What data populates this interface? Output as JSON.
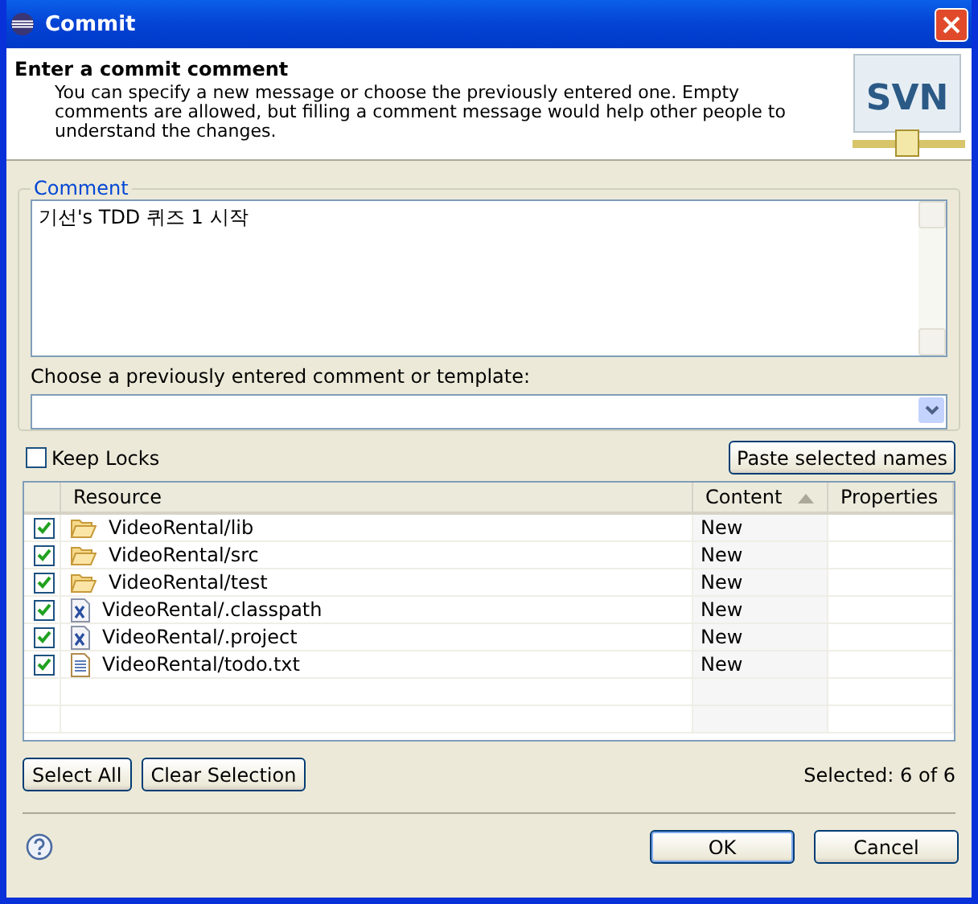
{
  "window": {
    "title": "Commit"
  },
  "header": {
    "logo_text": "SVN",
    "title": "Enter a commit comment",
    "description": "You can specify a new message or choose the previously entered one. Empty comments are allowed, but filling a comment message would help other people to understand the changes."
  },
  "comment_group": {
    "label": "Comment",
    "value": "기선's TDD 퀴즈 1 시작",
    "template_label": "Choose a previously entered comment or template:"
  },
  "keep_locks": {
    "label": "Keep Locks",
    "checked": false
  },
  "paste_button": "Paste selected names",
  "table": {
    "columns": [
      {
        "label": "Resource"
      },
      {
        "label": "Content",
        "sorted": true
      },
      {
        "label": "Properties"
      }
    ],
    "rows": [
      {
        "kind": "folder",
        "resource": "VideoRental/lib",
        "content": "New",
        "checked": true
      },
      {
        "kind": "folder",
        "resource": "VideoRental/src",
        "content": "New",
        "checked": true
      },
      {
        "kind": "folder",
        "resource": "VideoRental/test",
        "content": "New",
        "checked": true
      },
      {
        "kind": "xml",
        "resource": "VideoRental/.classpath",
        "content": "New",
        "checked": true
      },
      {
        "kind": "xml",
        "resource": "VideoRental/.project",
        "content": "New",
        "checked": true
      },
      {
        "kind": "text",
        "resource": "VideoRental/todo.txt",
        "content": "New",
        "checked": true
      }
    ]
  },
  "selection_buttons": [
    "Select All",
    "Clear Selection"
  ],
  "selected_count": "Selected: 6 of 6",
  "buttons": [
    "OK",
    "Cancel"
  ]
}
